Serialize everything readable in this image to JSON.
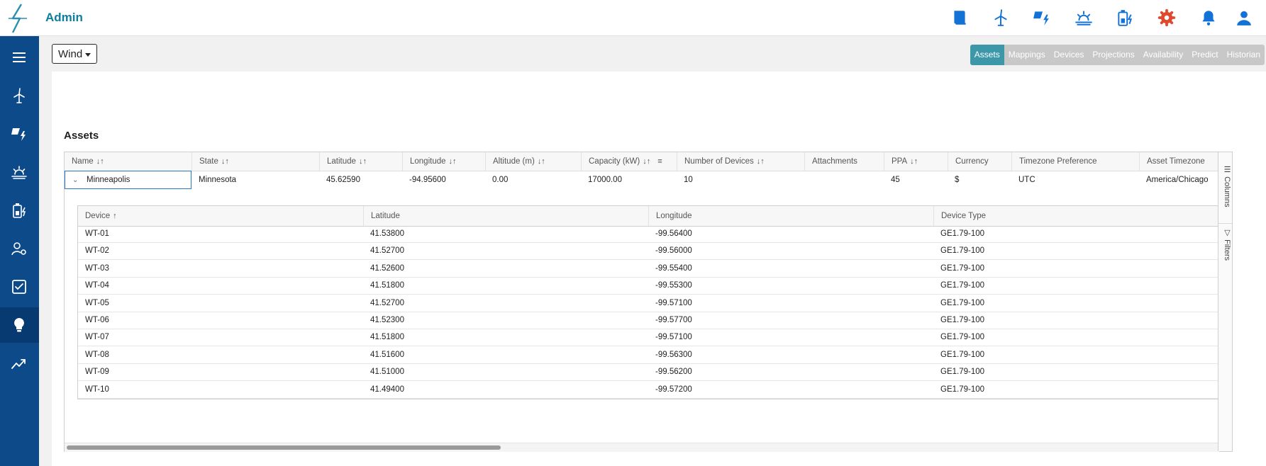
{
  "app": {
    "title": "Admin"
  },
  "topbar": {
    "icons": [
      "book-icon",
      "wind-turbine-icon",
      "solar-bolt-icon",
      "sunset-icon",
      "battery-bolt-icon",
      "gear-icon",
      "bell-icon",
      "user-icon"
    ],
    "gear_color": "#e0492d",
    "icon_color": "#1372d6"
  },
  "sidebar": {
    "items": [
      "menu-icon",
      "wind-turbine-icon",
      "solar-bolt-icon",
      "sunset-icon",
      "battery-bolt-icon",
      "user-settings-icon",
      "checklist-icon",
      "lightbulb-icon",
      "trend-icon"
    ],
    "active_index": 7,
    "background": "#0c4a8a"
  },
  "toolbar": {
    "dropdown_label": "Wind"
  },
  "tabs": [
    {
      "label": "Assets",
      "active": true
    },
    {
      "label": "Mappings",
      "active": false
    },
    {
      "label": "Devices",
      "active": false
    },
    {
      "label": "Projections",
      "active": false
    },
    {
      "label": "Availability",
      "active": false
    },
    {
      "label": "Predict",
      "active": false
    },
    {
      "label": "Historian",
      "active": false
    }
  ],
  "assets": {
    "title": "Assets",
    "columns": [
      "Name",
      "State",
      "Latitude",
      "Longitude",
      "Altitude (m)",
      "Capacity (kW)",
      "Number of Devices",
      "Attachments",
      "PPA",
      "Currency",
      "Timezone Preference",
      "Asset Timezone"
    ],
    "row": {
      "name": "Minneapolis",
      "state": "Minnesota",
      "latitude": "45.62590",
      "longitude": "-94.95600",
      "altitude": "0.00",
      "capacity": "17000.00",
      "devices": "10",
      "attachments": "",
      "ppa": "45",
      "currency": "$",
      "tz_pref": "UTC",
      "asset_tz": "America/Chicago"
    }
  },
  "devices": {
    "columns": [
      "Device",
      "Latitude",
      "Longitude",
      "Device Type"
    ],
    "rows": [
      [
        "WT-01",
        "41.53800",
        "-99.56400",
        "GE1.79-100"
      ],
      [
        "WT-02",
        "41.52700",
        "-99.56000",
        "GE1.79-100"
      ],
      [
        "WT-03",
        "41.52600",
        "-99.55400",
        "GE1.79-100"
      ],
      [
        "WT-04",
        "41.51800",
        "-99.55300",
        "GE1.79-100"
      ],
      [
        "WT-05",
        "41.52700",
        "-99.57100",
        "GE1.79-100"
      ],
      [
        "WT-06",
        "41.52300",
        "-99.57700",
        "GE1.79-100"
      ],
      [
        "WT-07",
        "41.51800",
        "-99.57100",
        "GE1.79-100"
      ],
      [
        "WT-08",
        "41.51600",
        "-99.56300",
        "GE1.79-100"
      ],
      [
        "WT-09",
        "41.51000",
        "-99.56200",
        "GE1.79-100"
      ],
      [
        "WT-10",
        "41.49400",
        "-99.57200",
        "GE1.79-100"
      ]
    ]
  },
  "side_panel": {
    "columns_label": "Columns",
    "filters_label": "Filters"
  }
}
